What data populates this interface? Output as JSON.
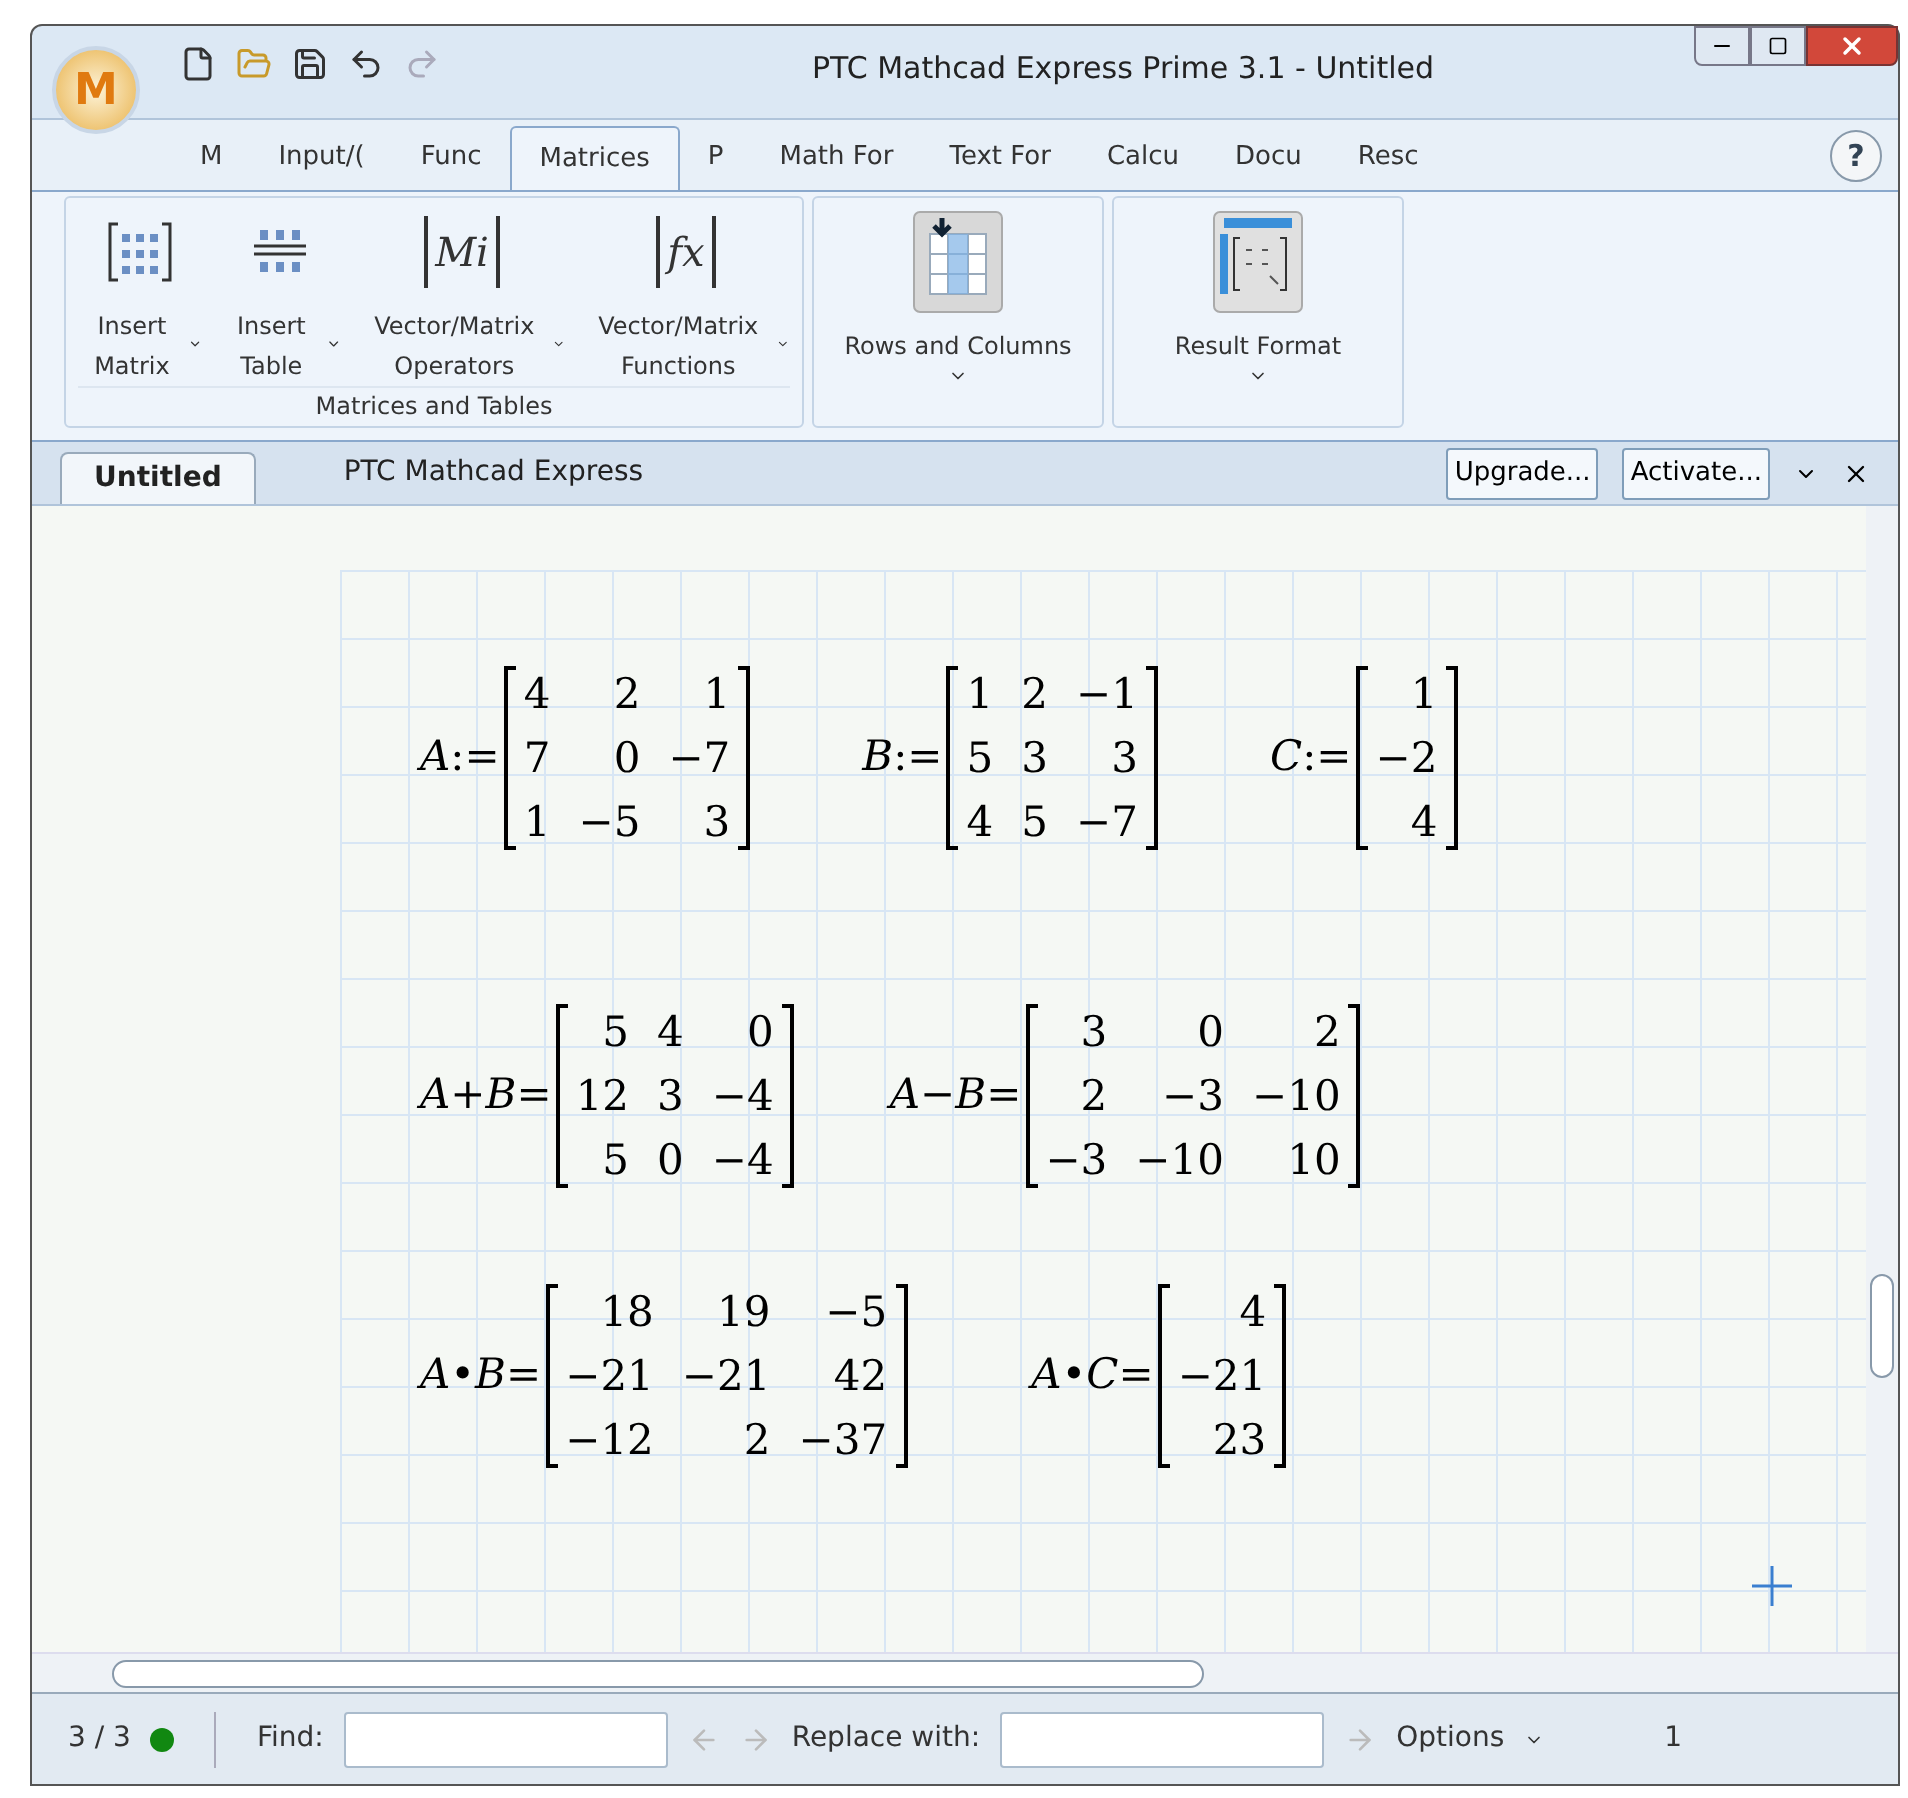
{
  "window": {
    "title": "PTC Mathcad Express Prime 3.1 - Untitled",
    "logo": "M"
  },
  "tabs": [
    {
      "label": "M",
      "selected": false
    },
    {
      "label": "Input/(",
      "selected": false
    },
    {
      "label": "Func",
      "selected": false
    },
    {
      "label": "Matrices",
      "selected": true
    },
    {
      "label": "P",
      "selected": false
    },
    {
      "label": "Math For",
      "selected": false
    },
    {
      "label": "Text For",
      "selected": false
    },
    {
      "label": "Calcu",
      "selected": false
    },
    {
      "label": "Docu",
      "selected": false
    },
    {
      "label": "Resc",
      "selected": false
    }
  ],
  "help": "?",
  "ribbon": {
    "groups": [
      {
        "label": "Matrices and Tables",
        "buttons": [
          {
            "kind": "matrix",
            "label": "Insert Matrix"
          },
          {
            "kind": "table",
            "label": "Insert Table"
          },
          {
            "kind": "glyph",
            "icon_text": "Mi",
            "label": "Vector/Matrix Operators"
          },
          {
            "kind": "glyph",
            "icon_text": "fx",
            "label": "Vector/Matrix Functions"
          }
        ]
      },
      {
        "buttons": [
          {
            "kind": "rows",
            "label": "Rows and Columns"
          }
        ]
      },
      {
        "buttons": [
          {
            "kind": "format",
            "label": "Result Format"
          }
        ]
      }
    ]
  },
  "document_tab": {
    "label": "Untitled",
    "selected": true
  },
  "document_title": "PTC Mathcad Express",
  "doc_buttons": [
    "Upgrade...",
    "Activate..."
  ],
  "worksheet": {
    "rows": [
      [
        {
          "lhs": "A",
          "op": ":=",
          "matrix": [
            [
              "4",
              "2",
              "1"
            ],
            [
              "7",
              "0",
              "−7"
            ],
            [
              "1",
              "−5",
              "3"
            ]
          ]
        },
        {
          "lhs": "B",
          "op": ":=",
          "matrix": [
            [
              "1",
              "2",
              "−1"
            ],
            [
              "5",
              "3",
              "3"
            ],
            [
              "4",
              "5",
              "−7"
            ]
          ]
        },
        {
          "lhs": "C",
          "op": ":=",
          "matrix": [
            [
              "1"
            ],
            [
              "−2"
            ],
            [
              "4"
            ]
          ]
        }
      ],
      [
        {
          "lhs": "A+B",
          "op": "=",
          "matrix": [
            [
              "5",
              "4",
              "0"
            ],
            [
              "12",
              "3",
              "−4"
            ],
            [
              "5",
              "0",
              "−4"
            ]
          ]
        },
        {
          "lhs": "A−B",
          "op": "=",
          "matrix": [
            [
              "3",
              "0",
              "2"
            ],
            [
              "2",
              "−3",
              "−10"
            ],
            [
              "−3",
              "−10",
              "10"
            ]
          ]
        }
      ],
      [
        {
          "lhs": "A•B",
          "op": "=",
          "matrix": [
            [
              "18",
              "19",
              "−5"
            ],
            [
              "−21",
              "−21",
              "42"
            ],
            [
              "−12",
              "2",
              "−37"
            ]
          ]
        },
        {
          "lhs": "A•C",
          "op": "=",
          "matrix": [
            [
              "4"
            ],
            [
              "−21"
            ],
            [
              "23"
            ]
          ]
        }
      ]
    ]
  },
  "status_bar": {
    "position": "3 / 3",
    "find_label": "Find:",
    "replace_label": "Replace with:",
    "options": "Options",
    "page": "1"
  }
}
